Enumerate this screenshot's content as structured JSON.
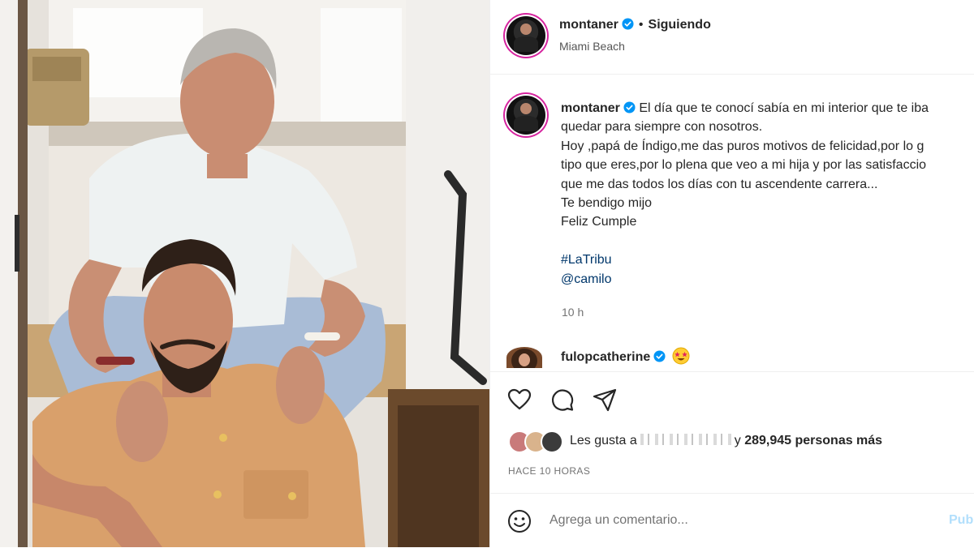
{
  "post": {
    "username": "montaner",
    "follow_separator": "•",
    "follow_status": "Siguiendo",
    "location": "Miami Beach",
    "caption_lines": [
      "El día que te conocí sabía en mi interior que te iba",
      "quedar para siempre con nosotros.",
      "Hoy ,papá de Índigo,me das puros motivos de felicidad,por lo g",
      "tipo que eres,por lo plena que veo a mi hija y por las satisfaccio",
      "que me das todos los días con tu ascendente carrera...",
      "Te bendigo mijo",
      "Feliz Cumple"
    ],
    "hashtag": "#LaTribu",
    "mention": "@camilo",
    "time": "10 h"
  },
  "comment": {
    "username": "fulopcatherine",
    "emoji": "star-struck-emoji"
  },
  "likes": {
    "prefix": "Les gusta a",
    "suffix": "y",
    "count_text": "289,945 personas más"
  },
  "timestamp": "HACE 10 HORAS",
  "add_comment": {
    "placeholder": "Agrega un comentario...",
    "publish_label": "Publ"
  },
  "icons": {
    "like": "heart-icon",
    "comment": "comment-bubble-icon",
    "share": "paper-plane-icon",
    "emoji": "smiley-icon",
    "verified": "verified-badge-icon"
  },
  "colors": {
    "verified_blue": "#0095f6",
    "link_blue": "#00376b",
    "story_ring": "#d6249f",
    "publish_disabled": "#b2dffc"
  }
}
